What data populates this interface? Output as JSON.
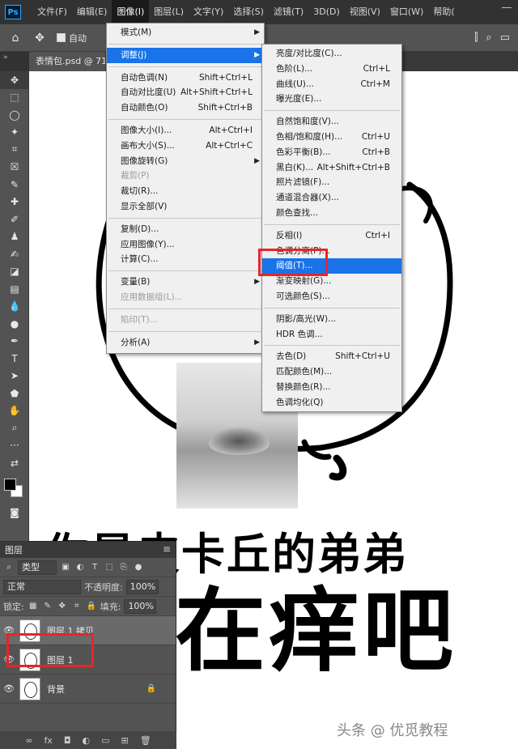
{
  "menubar": {
    "logo": "Ps",
    "items": [
      "文件(F)",
      "编辑(E)",
      "图像(I)",
      "图层(L)",
      "文字(Y)",
      "选择(S)",
      "滤镜(T)",
      "3D(D)",
      "视图(V)",
      "窗口(W)",
      "帮助("
    ],
    "active_index": 2
  },
  "options": {
    "auto_select_label": "自动"
  },
  "tab": {
    "doc_title": "表情包.psd @ 71..."
  },
  "image_menu": {
    "items": [
      {
        "label": "模式(M)",
        "sub": true
      },
      {
        "sep": true
      },
      {
        "label": "调整(J)",
        "sub": true,
        "highlight": true
      },
      {
        "sep": true
      },
      {
        "label": "自动色调(N)",
        "shortcut": "Shift+Ctrl+L"
      },
      {
        "label": "自动对比度(U)",
        "shortcut": "Alt+Shift+Ctrl+L"
      },
      {
        "label": "自动颜色(O)",
        "shortcut": "Shift+Ctrl+B"
      },
      {
        "sep": true
      },
      {
        "label": "图像大小(I)...",
        "shortcut": "Alt+Ctrl+I"
      },
      {
        "label": "画布大小(S)...",
        "shortcut": "Alt+Ctrl+C"
      },
      {
        "label": "图像旋转(G)",
        "sub": true
      },
      {
        "label": "裁剪(P)",
        "disabled": true
      },
      {
        "label": "裁切(R)..."
      },
      {
        "label": "显示全部(V)"
      },
      {
        "sep": true
      },
      {
        "label": "复制(D)..."
      },
      {
        "label": "应用图像(Y)..."
      },
      {
        "label": "计算(C)..."
      },
      {
        "sep": true
      },
      {
        "label": "变量(B)",
        "sub": true
      },
      {
        "label": "应用数据组(L)...",
        "disabled": true
      },
      {
        "sep": true
      },
      {
        "label": "陷印(T)...",
        "disabled": true
      },
      {
        "sep": true
      },
      {
        "label": "分析(A)",
        "sub": true
      }
    ]
  },
  "adjust_menu": {
    "items": [
      {
        "label": "亮度/对比度(C)..."
      },
      {
        "label": "色阶(L)...",
        "shortcut": "Ctrl+L"
      },
      {
        "label": "曲线(U)...",
        "shortcut": "Ctrl+M"
      },
      {
        "label": "曝光度(E)..."
      },
      {
        "sep": true
      },
      {
        "label": "自然饱和度(V)..."
      },
      {
        "label": "色相/饱和度(H)...",
        "shortcut": "Ctrl+U"
      },
      {
        "label": "色彩平衡(B)...",
        "shortcut": "Ctrl+B"
      },
      {
        "label": "黑白(K)...",
        "shortcut": "Alt+Shift+Ctrl+B"
      },
      {
        "label": "照片滤镜(F)..."
      },
      {
        "label": "通道混合器(X)..."
      },
      {
        "label": "颜色查找..."
      },
      {
        "sep": true
      },
      {
        "label": "反相(I)",
        "shortcut": "Ctrl+I"
      },
      {
        "label": "色调分离(P)..."
      },
      {
        "label": "阈值(T)...",
        "highlight": true
      },
      {
        "label": "渐变映射(G)..."
      },
      {
        "label": "可选颜色(S)..."
      },
      {
        "sep": true
      },
      {
        "label": "阴影/高光(W)..."
      },
      {
        "label": "HDR 色调..."
      },
      {
        "sep": true
      },
      {
        "label": "去色(D)",
        "shortcut": "Shift+Ctrl+U"
      },
      {
        "label": "匹配颜色(M)..."
      },
      {
        "label": "替换颜色(R)..."
      },
      {
        "label": "色调均化(Q)"
      }
    ]
  },
  "canvas": {
    "caption_line1": "你是皮卡丘的弟弟",
    "caption_line2": "在痒吧",
    "watermark": "头条 @ 优觅教程"
  },
  "layers": {
    "title": "图层",
    "filter_label": "类型",
    "blend_mode": "正常",
    "opacity_label": "不透明度:",
    "opacity_value": "100%",
    "lock_label": "锁定:",
    "fill_label": "填充:",
    "fill_value": "100%",
    "items": [
      {
        "name": "图层 1 拷贝",
        "selected": true
      },
      {
        "name": "图层 1"
      },
      {
        "name": "背景",
        "locked": true
      }
    ]
  }
}
